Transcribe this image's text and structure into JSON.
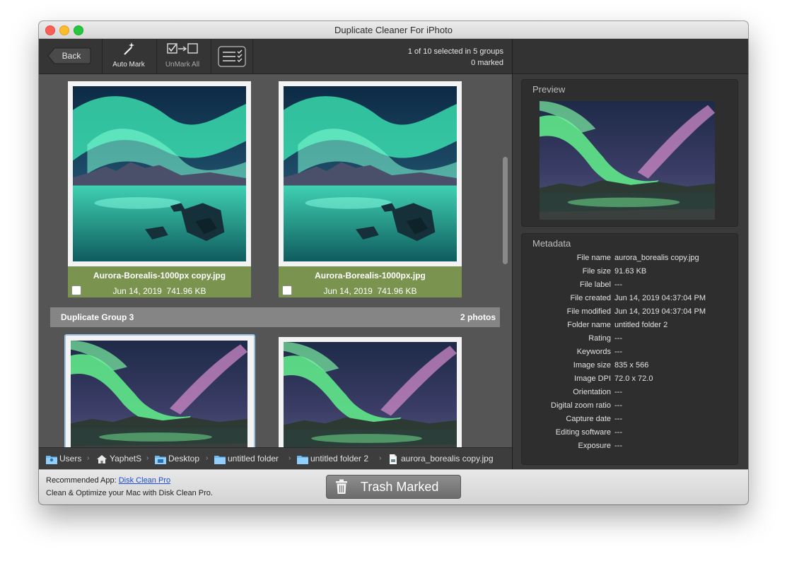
{
  "window": {
    "title": "Duplicate Cleaner For iPhoto"
  },
  "toolbar": {
    "back_label": "Back",
    "auto_mark_label": "Auto Mark",
    "unmark_all_label": "UnMark All",
    "selection_info": "1 of 10 selected in 5 groups",
    "marked_info": "0 marked"
  },
  "group2": {
    "photos": [
      {
        "name": "Aurora-Borealis-1000px copy.jpg",
        "date": "Jun 14, 2019",
        "size": "741.96 KB",
        "checked": false
      },
      {
        "name": "Aurora-Borealis-1000px.jpg",
        "date": "Jun 14, 2019",
        "size": "741.96 KB",
        "checked": false
      }
    ]
  },
  "group3": {
    "title": "Duplicate Group 3",
    "count": "2 photos"
  },
  "pathbar": {
    "items": [
      "Users",
      "YaphetS",
      "Desktop",
      "untitled folder",
      "untitled folder 2",
      "aurora_borealis copy.jpg"
    ]
  },
  "preview": {
    "title": "Preview"
  },
  "metadata": {
    "title": "Metadata",
    "rows": [
      {
        "key": "File name",
        "value": "aurora_borealis copy.jpg"
      },
      {
        "key": "File size",
        "value": "91.63 KB"
      },
      {
        "key": "File label",
        "value": "---"
      },
      {
        "key": "File created",
        "value": "Jun 14, 2019 04:37:04 PM"
      },
      {
        "key": "File modified",
        "value": "Jun 14, 2019 04:37:04 PM"
      },
      {
        "key": "Folder name",
        "value": "untitled folder 2"
      },
      {
        "key": "Rating",
        "value": "---"
      },
      {
        "key": "Keywords",
        "value": "---"
      },
      {
        "key": "Image size",
        "value": "835 x 566"
      },
      {
        "key": "Image DPI",
        "value": "72.0 x 72.0"
      },
      {
        "key": "Orientation",
        "value": "---"
      },
      {
        "key": "Digital zoom ratio",
        "value": "---"
      },
      {
        "key": "Capture date",
        "value": "---"
      },
      {
        "key": "Editing software",
        "value": "---"
      },
      {
        "key": "Exposure",
        "value": "---"
      }
    ]
  },
  "footer": {
    "recommended_prefix": "Recommended App:",
    "recommended_link": "Disk Clean Pro",
    "recommended_desc": "Clean & Optimize your Mac with Disk Clean Pro.",
    "trash_label": "Trash Marked"
  },
  "colors": {
    "info_bar": "#7a9450",
    "content_bg": "#555555",
    "group_header": "#858585",
    "link": "#1a4fd6"
  }
}
